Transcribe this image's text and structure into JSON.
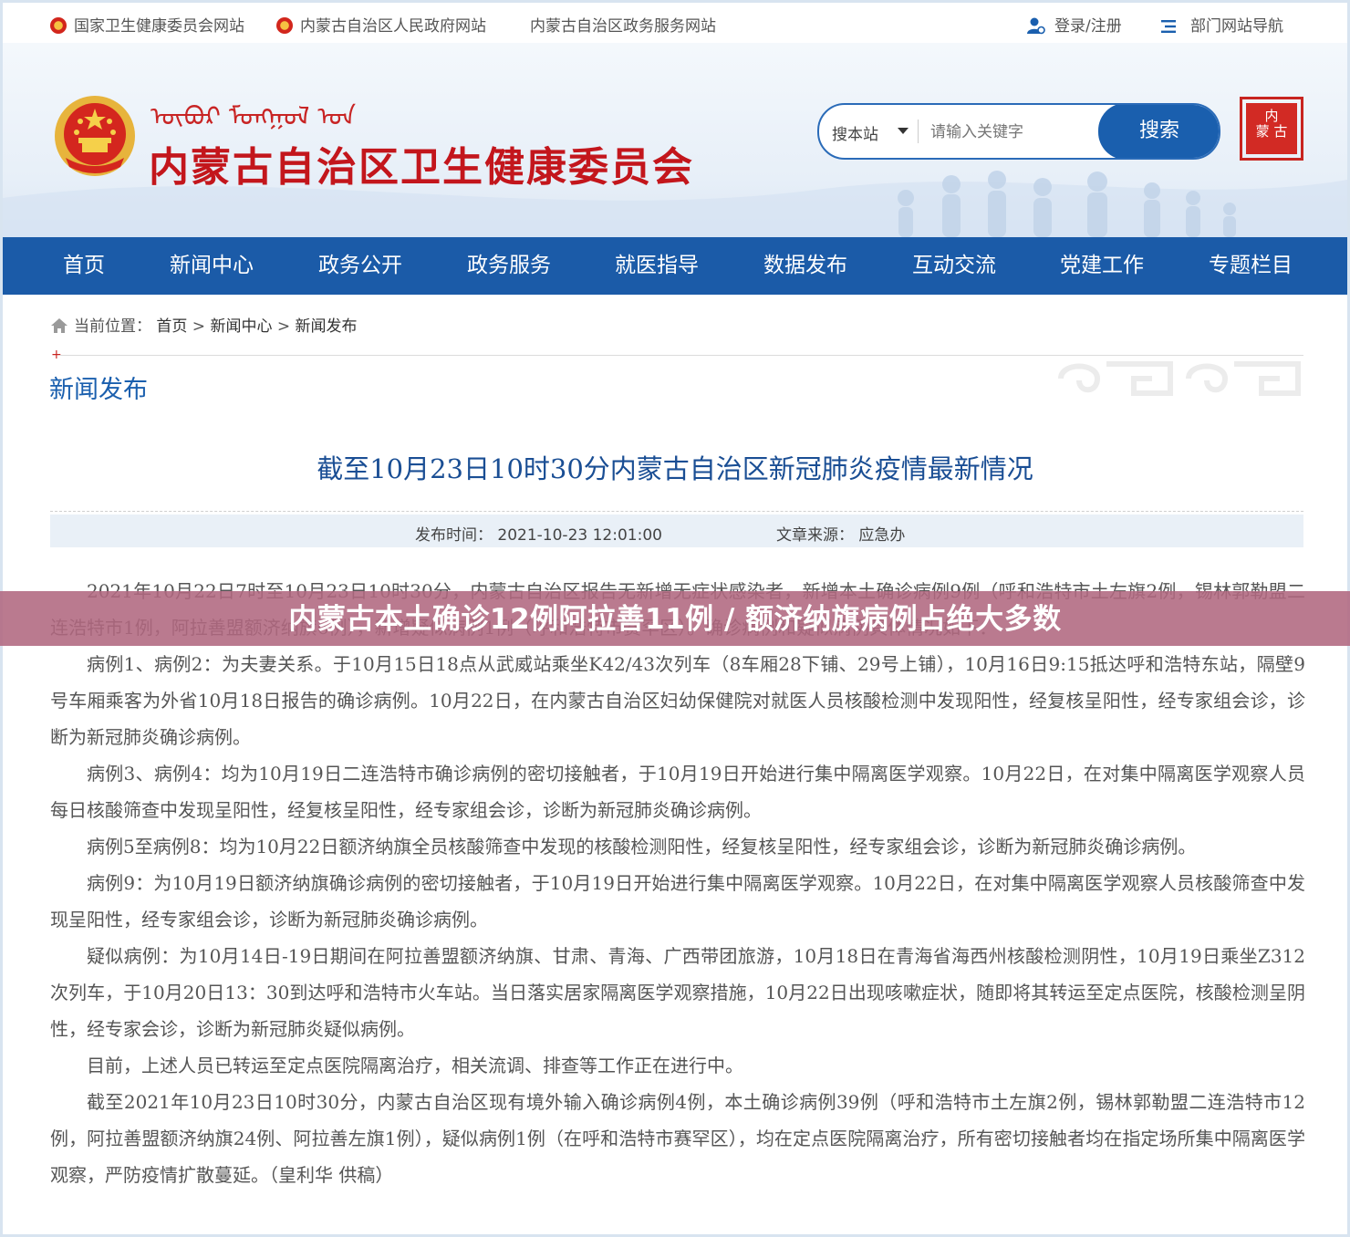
{
  "topbar": {
    "link1": "国家卫生健康委员会网站",
    "link2": "内蒙古自治区人民政府网站",
    "link3": "内蒙古自治区政务服务网站",
    "login": "登录/注册",
    "dept_nav": "部门网站导航"
  },
  "header": {
    "mongolian_script": "ᠦᠪᠦᠷ ᠮᠣᠩᠭᠣᠯ ᠤᠨ",
    "title": "内蒙古自治区卫生健康委员会",
    "search": {
      "scope": "搜本站",
      "placeholder": "请输入关键字",
      "button": "搜索"
    },
    "seal_text": "内蒙古"
  },
  "nav": [
    "首页",
    "新闻中心",
    "政务公开",
    "政务服务",
    "就医指导",
    "数据发布",
    "互动交流",
    "党建工作",
    "专题栏目"
  ],
  "breadcrumb": {
    "label": "当前位置：",
    "home": "首页",
    "sep1": " > ",
    "level1": "新闻中心",
    "sep2": " > ",
    "level2": "新闻发布"
  },
  "section": {
    "plus": "+",
    "title": "新闻发布"
  },
  "article": {
    "title": "截至10月23日10时30分内蒙古自治区新冠肺炎疫情最新情况",
    "publish_time": "发布时间： 2021-10-23 12:01:00",
    "source": "文章来源： 应急办",
    "paragraphs": [
      "2021年10月22日7时至10月23日10时30分，内蒙古自治区报告无新增无症状感染者，新增本土确诊病例9例（呼和浩特市土左旗2例，锡林郭勒盟二连浩特市1例，阿拉善盟额济纳旗6例），新增疑似病例1例（呼和浩特市赛罕区）。确诊病例和疑似病例具体情况如下：",
      "病例1、病例2：为夫妻关系。于10月15日18点从武威站乘坐K42/43次列车（8车厢28下铺、29号上铺），10月16日9:15抵达呼和浩特东站，隔壁9号车厢乘客为外省10月18日报告的确诊病例。10月22日，在内蒙古自治区妇幼保健院对就医人员核酸检测中发现阳性，经复核呈阳性，经专家组会诊，诊断为新冠肺炎确诊病例。",
      "病例3、病例4：均为10月19日二连浩特市确诊病例的密切接触者，于10月19日开始进行集中隔离医学观察。10月22日，在对集中隔离医学观察人员每日核酸筛查中发现呈阳性，经复核呈阳性，经专家组会诊，诊断为新冠肺炎确诊病例。",
      "病例5至病例8：均为10月22日额济纳旗全员核酸筛查中发现的核酸检测阳性，经复核呈阳性，经专家组会诊，诊断为新冠肺炎确诊病例。",
      "病例9：为10月19日额济纳旗确诊病例的密切接触者，于10月19日开始进行集中隔离医学观察。10月22日，在对集中隔离医学观察人员核酸筛查中发现呈阳性，经专家组会诊，诊断为新冠肺炎确诊病例。",
      "疑似病例：为10月14日-19日期间在阿拉善盟额济纳旗、甘肃、青海、广西带团旅游，10月18日在青海省海西州核酸检测阴性，10月19日乘坐Z312次列车，于10月20日13：30到达呼和浩特市火车站。当日落实居家隔离医学观察措施，10月22日出现咳嗽症状，随即将其转运至定点医院，核酸检测呈阴性，经专家会诊，诊断为新冠肺炎疑似病例。",
      "目前，上述人员已转运至定点医院隔离治疗，相关流调、排查等工作正在进行中。",
      "截至2021年10月23日10时30分，内蒙古自治区现有境外输入确诊病例4例，本土确诊病例39例（呼和浩特市土左旗2例，锡林郭勒盟二连浩特市12例，阿拉善盟额济纳旗24例、阿拉善左旗1例），疑似病例1例（在呼和浩特市赛罕区），均在定点医院隔离治疗，所有密切接触者均在指定场所集中隔离医学观察，严防疫情扩散蔓延。（皇利华  供稿）"
    ]
  },
  "overlay_headline": "内蒙古本土确诊12例阿拉善11例 / 额济纳旗病例占绝大多数",
  "colors": {
    "nav_blue": "#1b5ba8",
    "title_red": "#c3161c",
    "link_blue": "#1a5fae",
    "overlay": "#b06880"
  }
}
